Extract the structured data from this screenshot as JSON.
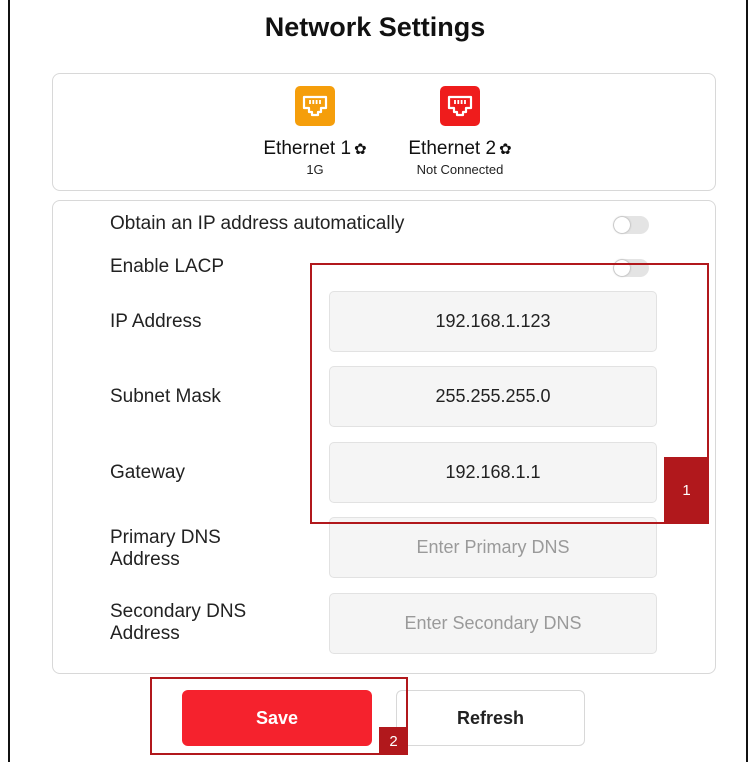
{
  "page": {
    "title": "Network Settings"
  },
  "ethernet": [
    {
      "name": "Ethernet 1",
      "status": "1G",
      "color": "#f59e0b",
      "icon": "ethernet-port-icon"
    },
    {
      "name": "Ethernet 2",
      "status": "Not Connected",
      "color": "#ef1c1c",
      "icon": "ethernet-port-icon"
    }
  ],
  "form": {
    "auto_ip_label": "Obtain an IP address automatically",
    "auto_ip_enabled": false,
    "lacp_label": "Enable LACP",
    "lacp_enabled": false,
    "ip_label": "IP Address",
    "ip_value": "192.168.1.123",
    "subnet_label": "Subnet Mask",
    "subnet_value": "255.255.255.0",
    "gateway_label": "Gateway",
    "gateway_value": "192.168.1.1",
    "primary_dns_label": "Primary DNS Address",
    "primary_dns_placeholder": "Enter Primary DNS",
    "secondary_dns_label": "Secondary DNS Address",
    "secondary_dns_placeholder": "Enter Secondary DNS"
  },
  "actions": {
    "save_label": "Save",
    "refresh_label": "Refresh"
  },
  "callouts": {
    "first": "1",
    "second": "2",
    "color": "#b1181c"
  },
  "colors": {
    "accent": "#f5222d"
  }
}
